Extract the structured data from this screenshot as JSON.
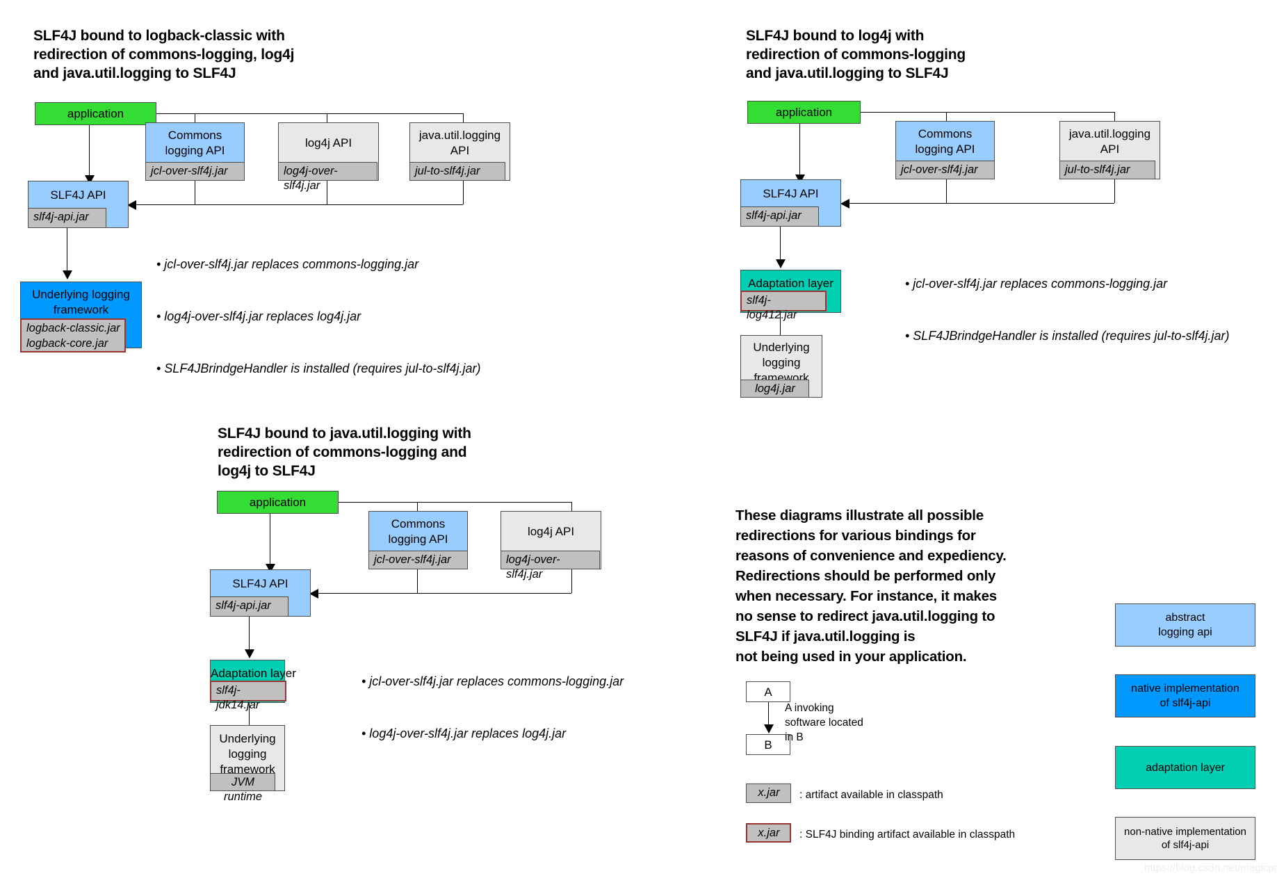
{
  "diagram1": {
    "title": "SLF4J bound to logback-classic with\nredirection of commons-logging, log4j\nand java.util.logging to SLF4J",
    "application": "application",
    "commons": "Commons\nlogging API",
    "commons_jar": "jcl-over-slf4j.jar",
    "log4japi": "log4j API",
    "log4japi_jar": "log4j-over-slf4j.jar",
    "jul": "java.util.logging\nAPI",
    "jul_jar": "jul-to-slf4j.jar",
    "slf4japi": "SLF4J API",
    "slf4japi_jar": "slf4j-api.jar",
    "underlying": "Underlying logging\nframework",
    "underlying_jar": "logback-classic.jar\nlogback-core.jar",
    "bullets": [
      "• jcl-over-slf4j.jar replaces commons-logging.jar",
      "• log4j-over-slf4j.jar replaces log4j.jar",
      "• SLF4JBrindgeHandler is installed (requires jul-to-slf4j.jar)"
    ]
  },
  "diagram2": {
    "title": "SLF4J bound to log4j with\nredirection of commons-logging\nand java.util.logging to SLF4J",
    "application": "application",
    "commons": "Commons\nlogging API",
    "commons_jar": "jcl-over-slf4j.jar",
    "jul": "java.util.logging\nAPI",
    "jul_jar": "jul-to-slf4j.jar",
    "slf4japi": "SLF4J API",
    "slf4japi_jar": "slf4j-api.jar",
    "adaptation": "Adaptation layer",
    "adaptation_jar": "slf4j-log412.jar",
    "underlying": "Underlying\nlogging\nframework",
    "underlying_jar": "log4j.jar",
    "bullets": [
      "• jcl-over-slf4j.jar replaces commons-logging.jar",
      "• SLF4JBrindgeHandler is installed (requires jul-to-slf4j.jar)"
    ]
  },
  "diagram3": {
    "title": "SLF4J bound to java.util.logging with\nredirection of commons-logging and\nlog4j to SLF4J",
    "application": "application",
    "commons": "Commons\nlogging API",
    "commons_jar": "jcl-over-slf4j.jar",
    "log4japi": "log4j API",
    "log4japi_jar": "log4j-over-slf4j.jar",
    "slf4japi": "SLF4J API",
    "slf4japi_jar": "slf4j-api.jar",
    "adaptation": "Adaptation layer",
    "adaptation_jar": "slf4j-jdk14.jar",
    "underlying": "Underlying\nlogging\nframework",
    "underlying_jar": "JVM runtime",
    "bullets": [
      "• jcl-over-slf4j.jar replaces commons-logging.jar",
      "• log4j-over-slf4j.jar replaces log4j.jar"
    ]
  },
  "note": {
    "text": "These diagrams illustrate all possible\nredirections for various bindings for\nreasons of convenience and expediency.\nRedirections should be performed only\nwhen necessary. For instance, it makes\nno sense to redirect java.util.logging to\nSLF4J if java.util.logging is\nnot being used in your application."
  },
  "legend": {
    "box_a": "A",
    "box_b": "B",
    "invoke_note": "A invoking\nsoftware located\nin B",
    "jar_plain": "x.jar",
    "jar_plain_note": ": artifact available in classpath",
    "jar_binding": "x.jar",
    "jar_binding_note": ": SLF4J binding artifact available in classpath",
    "swatches": [
      {
        "label": "abstract\nlogging api",
        "color": "#99ccff"
      },
      {
        "label": "native implementation\nof slf4j-api",
        "color": "#0099ff"
      },
      {
        "label": "adaptation layer",
        "color": "#00cfb4"
      },
      {
        "label": "non-native implementation\nof slf4j-api",
        "color": "#e8e8e8"
      }
    ]
  },
  "watermark": "https://blog.csdn.net/magicproblem"
}
